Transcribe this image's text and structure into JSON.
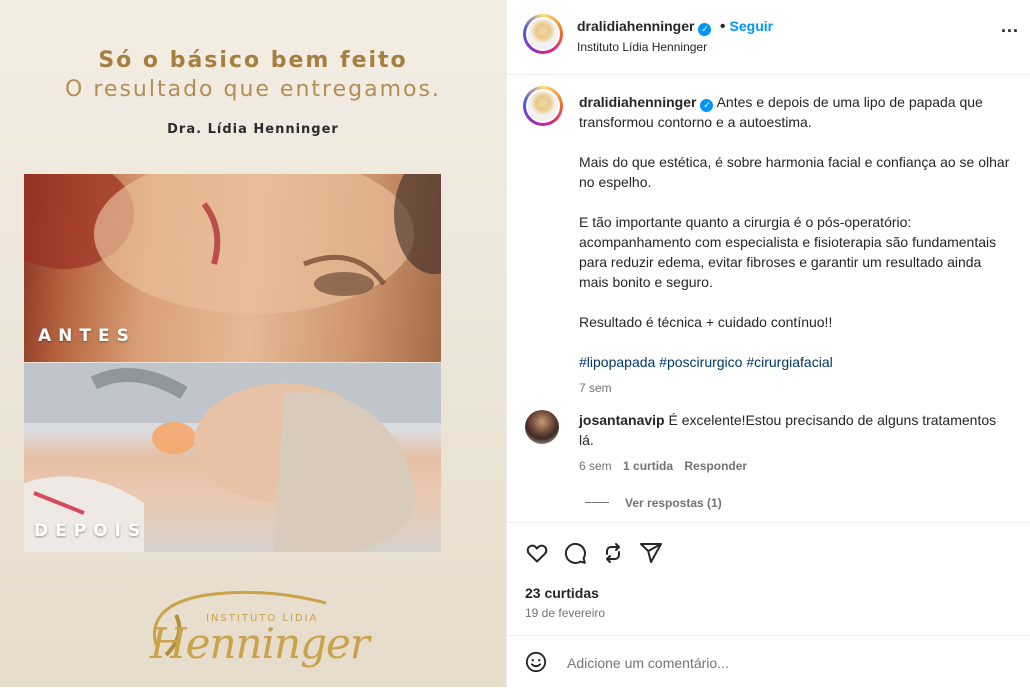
{
  "media": {
    "headline_line1": "Só o básico bem feito",
    "headline_line2": "O resultado que entregamos.",
    "doctor": "Dra. Lídia Henninger",
    "label_before": "ANTES",
    "label_after": "DEPOIS",
    "logo_institute": "INSTITUTO LIDIA",
    "logo_name": "Henninger"
  },
  "header": {
    "username": "dralidiahenninger",
    "separator": "•",
    "follow_label": "Seguir",
    "subtitle": "Instituto Lídia Henninger",
    "more": "..."
  },
  "caption": {
    "username": "dralidiahenninger",
    "paragraph1": "Antes e depois de uma lipo de papada que transformou contorno e a autoestima.",
    "paragraph2": "Mais do que estética, é sobre harmonia facial e confiança ao se olhar no espelho.",
    "paragraph3": "E tão importante quanto a cirurgia é o pós-operatório: acompanhamento com especialista e fisioterapia são fundamentais para reduzir edema, evitar fibroses e garantir um resultado ainda mais bonito e seguro.",
    "paragraph4": "Resultado é técnica + cuidado contínuo!!",
    "hashtags": "#lipopapada #poscirurgico #cirurgiafacial",
    "time": "7 sem"
  },
  "comment": {
    "username": "josantanavip",
    "text": "É excelente!Estou precisando de alguns tratamentos lá.",
    "time": "6 sem",
    "likes": "1 curtida",
    "reply_label": "Responder",
    "view_replies": "Ver respostas (1)"
  },
  "actions": {
    "like_icon": "heart-icon",
    "comment_icon": "comment-icon",
    "share_icon": "repost-icon",
    "send_icon": "send-icon",
    "likes_count": "23 curtidas",
    "date": "19 de fevereiro"
  },
  "add_comment": {
    "placeholder": "Adicione um comentário..."
  },
  "colors": {
    "accent": "#0095f6",
    "gold": "#a57f3e",
    "hashtag": "#00376b",
    "muted": "#737373"
  }
}
